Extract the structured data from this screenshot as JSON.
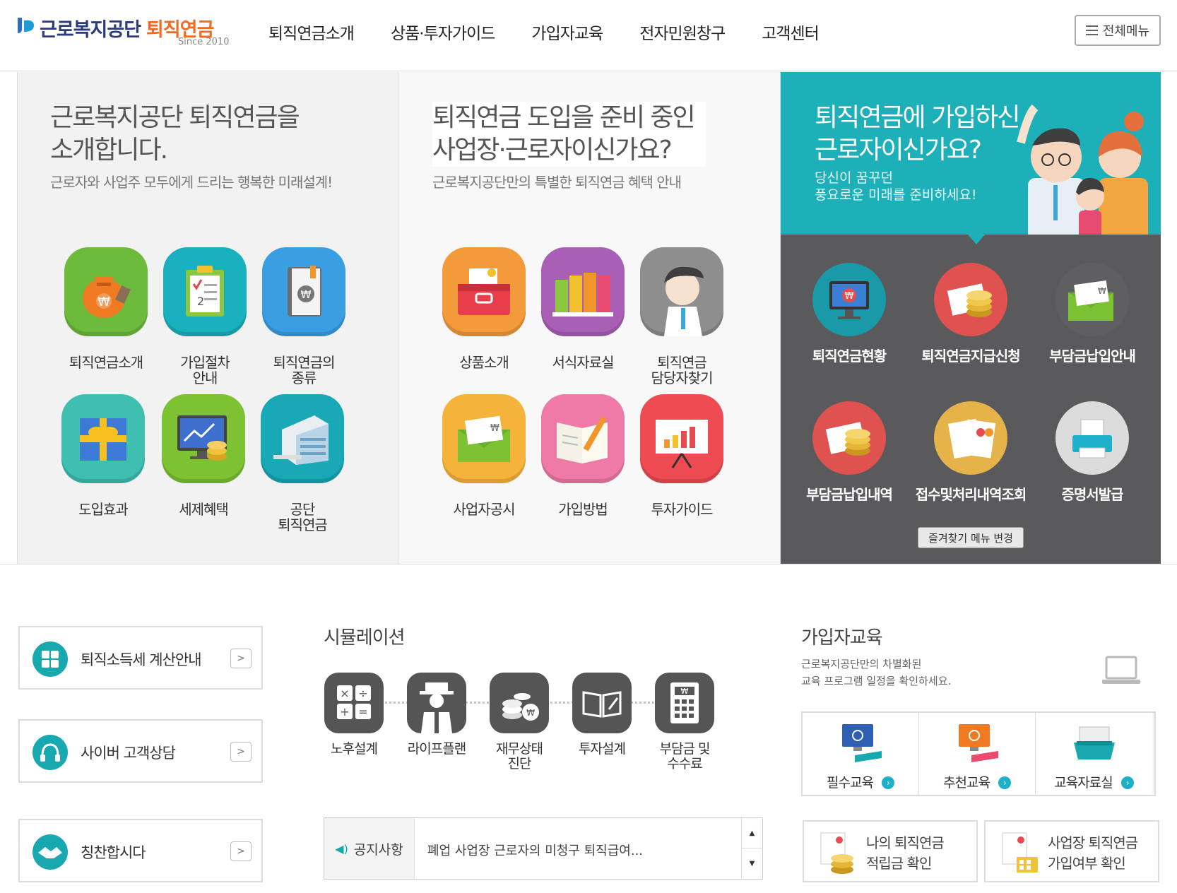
{
  "header": {
    "logo_main": "근로복지공단",
    "logo_accent": "퇴직연금",
    "logo_since": "Since 2010",
    "nav": [
      "퇴직연금소개",
      "상품·투자가이드",
      "가입자교육",
      "전자민원창구",
      "고객센터"
    ],
    "all_menu_label": "전체메뉴"
  },
  "panel_intro": {
    "title_line1": "근로복지공단 퇴직연금을",
    "title_line2": "소개합니다.",
    "subtitle": "근로자와 사업주 모두에게 드리는 행복한 미래설계!",
    "items": [
      {
        "label": "퇴직연금소개",
        "icon": "money-bag-icon"
      },
      {
        "label": "가입절차\n안내",
        "icon": "clipboard-icon"
      },
      {
        "label": "퇴직연금의\n종류",
        "icon": "book-won-icon"
      },
      {
        "label": "도입효과",
        "icon": "gift-icon"
      },
      {
        "label": "세제혜택",
        "icon": "monitor-coins-icon"
      },
      {
        "label": "공단\n퇴직연금",
        "icon": "building-icon"
      }
    ]
  },
  "panel_prep": {
    "title_line1": "퇴직연금 도입을 준비 중인",
    "title_line2": "사업장·근로자이신가요?",
    "subtitle": "근로복지공단만의 특별한 퇴직연금 혜택 안내",
    "items": [
      {
        "label": "상품소개",
        "icon": "toolbox-icon"
      },
      {
        "label": "서식자료실",
        "icon": "binders-icon"
      },
      {
        "label": "퇴직연금\n담당자찾기",
        "icon": "person-icon"
      },
      {
        "label": "사업자공시",
        "icon": "envelope-icon"
      },
      {
        "label": "가입방법",
        "icon": "notebook-pen-icon"
      },
      {
        "label": "투자가이드",
        "icon": "presentation-icon"
      }
    ]
  },
  "panel_member": {
    "title_line1": "퇴직연금에 가입하신",
    "title_line2": "근로자이신가요?",
    "sub_line1": "당신이 꿈꾸던",
    "sub_line2": "풍요로운 미래를 준비하세요!",
    "items": [
      {
        "label": "퇴직연금현황",
        "icon": "monitor-won-icon",
        "color": "#1a9aa8"
      },
      {
        "label": "퇴직연금지급신청",
        "icon": "paper-coins-icon",
        "color": "#e0524f"
      },
      {
        "label": "부담금납입안내",
        "icon": "envelope-won-icon",
        "color": "#5a5a5d"
      },
      {
        "label": "부담금납입내역",
        "icon": "paper-coins-icon",
        "color": "#e0524f"
      },
      {
        "label": "접수및처리내역조회",
        "icon": "certificates-icon",
        "color": "#e6b24a"
      },
      {
        "label": "증명서발급",
        "icon": "printer-icon",
        "color": "#dcdcdc"
      }
    ],
    "fav_button": "즐겨찾기 메뉴 변경"
  },
  "side_links": [
    {
      "label": "퇴직소득세 계산안내",
      "icon": "calculator-icon"
    },
    {
      "label": "사이버 고객상담",
      "icon": "headset-icon"
    },
    {
      "label": "칭찬합시다",
      "icon": "handshake-icon"
    }
  ],
  "simulation": {
    "title": "시뮬레이션",
    "items": [
      {
        "label": "노후설계",
        "icon": "calculator-icon"
      },
      {
        "label": "라이프플랜",
        "icon": "old-man-icon"
      },
      {
        "label": "재무상태\n진단",
        "icon": "coins-icon"
      },
      {
        "label": "투자설계",
        "icon": "open-book-icon"
      },
      {
        "label": "부담금 및\n수수료",
        "icon": "calc-won-icon"
      }
    ]
  },
  "notice": {
    "label": "공지사항",
    "text": "폐업 사업장 근로자의 미청구 퇴직급여...",
    "up": "▲",
    "down": "▼"
  },
  "education": {
    "title": "가입자교육",
    "desc_line1": "근로복지공단만의 차별화된",
    "desc_line2": "교육 프로그램 일정을 확인하세요.",
    "items": [
      {
        "label": "필수교육",
        "icon": "monitor-book-icon"
      },
      {
        "label": "추천교육",
        "icon": "monitor-book-icon"
      },
      {
        "label": "교육자료실",
        "icon": "file-box-icon"
      }
    ],
    "go": "›"
  },
  "cards": [
    {
      "label": "나의 퇴직연금\n적립금 확인",
      "icon": "certificate-coins-icon"
    },
    {
      "label": "사업장 퇴직연금\n가입여부 확인",
      "icon": "certificate-building-icon"
    }
  ]
}
